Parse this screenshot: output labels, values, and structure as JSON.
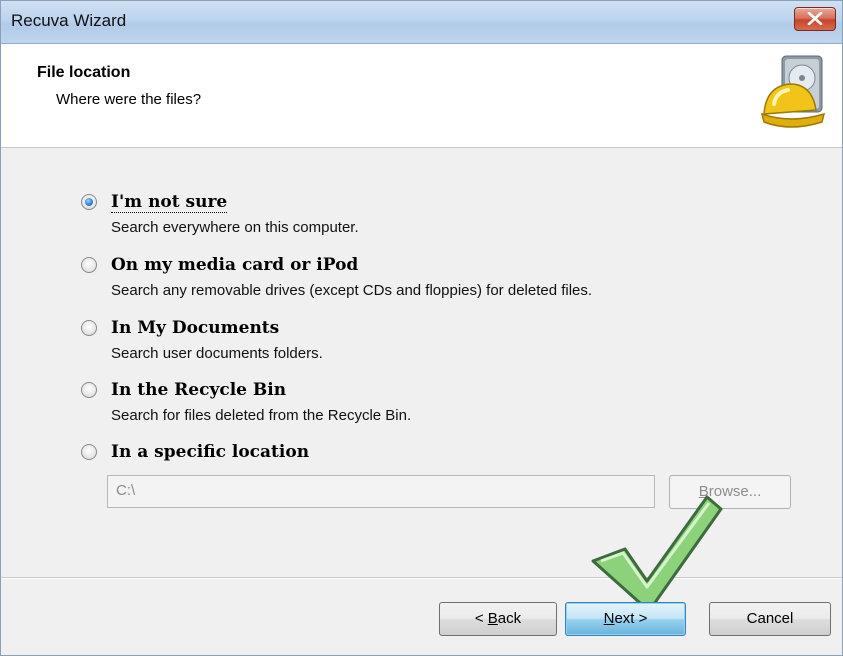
{
  "window": {
    "title": "Recuva Wizard"
  },
  "header": {
    "title": "File location",
    "subtitle": "Where were the files?"
  },
  "options": [
    {
      "label": "I'm not sure",
      "description": "Search everywhere on this computer.",
      "selected": true
    },
    {
      "label": "On my media card or iPod",
      "description": "Search any removable drives (except CDs and floppies) for deleted files.",
      "selected": false
    },
    {
      "label": "In My Documents",
      "description": "Search user documents folders.",
      "selected": false
    },
    {
      "label": "In the Recycle Bin",
      "description": "Search for files deleted from the Recycle Bin.",
      "selected": false
    },
    {
      "label": "In a specific location",
      "description": "",
      "selected": false
    }
  ],
  "location": {
    "value": "C:\\",
    "browse_prefix": "",
    "browse_mnemonic": "B",
    "browse_rest": "rowse..."
  },
  "buttons": {
    "back_prefix": "< ",
    "back_mnemonic": "B",
    "back_rest": "ack",
    "next_mnemonic": "N",
    "next_rest": "ext >",
    "cancel": "Cancel"
  },
  "colors": {
    "accent_check": "#8bd27a",
    "check_outline": "#3d6b3d",
    "title_bar": "#bcd4ee"
  }
}
